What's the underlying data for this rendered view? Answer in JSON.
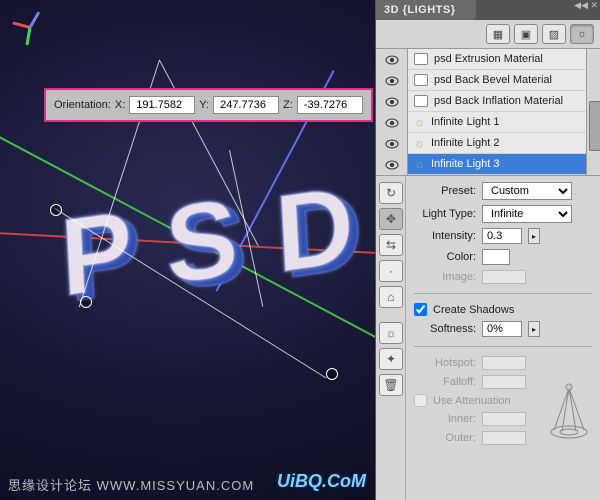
{
  "panel": {
    "title": "3D {LIGHTS}",
    "layers": [
      {
        "label": "psd Extrusion Material",
        "kind": "material"
      },
      {
        "label": "psd Back Bevel Material",
        "kind": "material"
      },
      {
        "label": "psd Back Inflation Material",
        "kind": "material"
      },
      {
        "label": "Infinite Light 1",
        "kind": "light"
      },
      {
        "label": "Infinite Light 2",
        "kind": "light"
      },
      {
        "label": "Infinite Light 3",
        "kind": "light",
        "selected": true
      }
    ]
  },
  "props": {
    "preset_label": "Preset:",
    "preset_value": "Custom",
    "lighttype_label": "Light Type:",
    "lighttype_value": "Infinite",
    "intensity_label": "Intensity:",
    "intensity_value": "0.3",
    "color_label": "Color:",
    "image_label": "Image:",
    "create_shadows_label": "Create Shadows",
    "create_shadows_checked": true,
    "softness_label": "Softness:",
    "softness_value": "0%",
    "hotspot_label": "Hotspot:",
    "falloff_label": "Falloff:",
    "use_attenuation_label": "Use Attenuation",
    "inner_label": "Inner:",
    "outer_label": "Outer:"
  },
  "orientation": {
    "label": "Orientation:",
    "x_label": "X:",
    "x_value": "191.7582",
    "y_label": "Y:",
    "y_value": "247.7736",
    "z_label": "Z:",
    "z_value": "-39.7276"
  },
  "watermarks": {
    "left": "思缘设计论坛  WWW.MISSYUAN.COM",
    "right": "UiBQ.CoM"
  },
  "icons": {
    "scene": "scene-icon",
    "mesh": "mesh-icon",
    "material": "material-icon",
    "light": "light-icon"
  }
}
